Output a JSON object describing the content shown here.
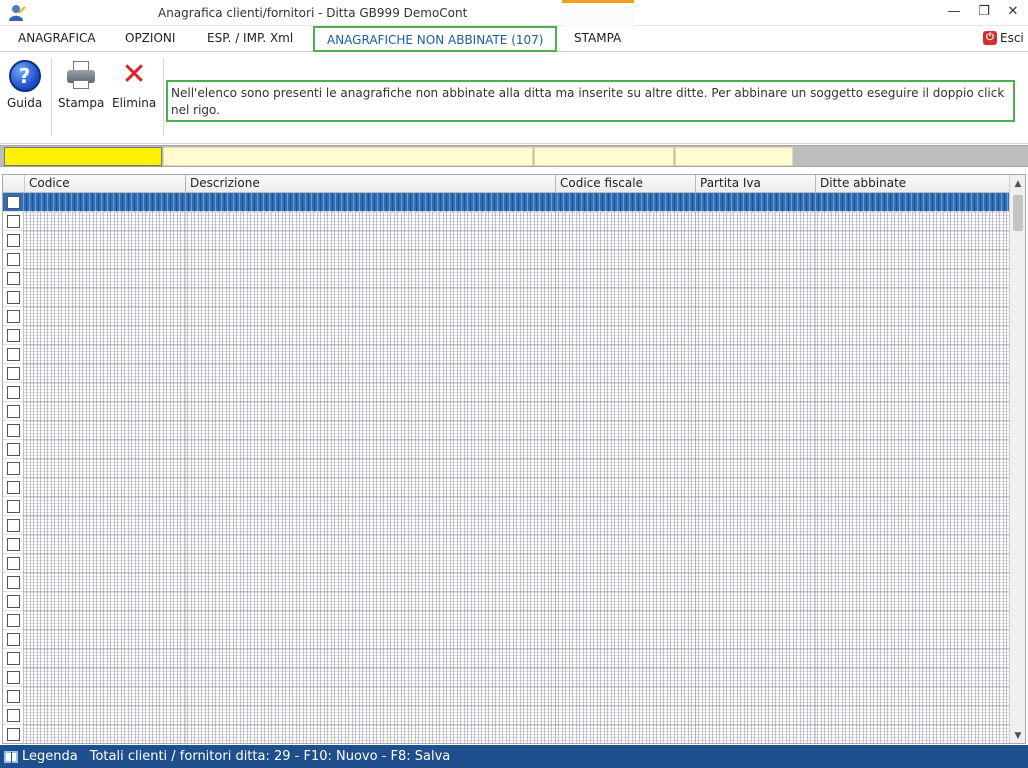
{
  "window": {
    "title": "Anagrafica clienti/fornitori - Ditta GB999 DemoCont",
    "min_glyph": "—",
    "max_glyph": "❐",
    "close_glyph": "✕"
  },
  "menu": {
    "tabs": [
      {
        "label": "ANAGRAFICA"
      },
      {
        "label": "OPZIONI"
      },
      {
        "label": "ESP. / IMP. Xml"
      },
      {
        "label": "ANAGRAFICHE NON ABBINATE (107)"
      },
      {
        "label": "STAMPA"
      }
    ],
    "active_tab": "ANAGRAFICHE NON ABBINATE (107)",
    "exit_label": "Esci"
  },
  "toolbar": {
    "help_label": "Guida",
    "print_label": "Stampa",
    "delete_label": "Elimina",
    "info_text": "Nell'elenco sono presenti le anagrafiche non abbinate alla ditta ma inserite su altre ditte. Per abbinare un soggetto eseguire il doppio click nel rigo."
  },
  "grid": {
    "columns": [
      "Codice",
      "Descrizione",
      "Codice fiscale",
      "Partita Iva",
      "Ditte abbinate"
    ],
    "visible_rows": 29,
    "selected_row": 0
  },
  "status": {
    "legend_label": "Legenda",
    "summary": "Totali clienti / fornitori ditta: 29  -  F10: Nuovo - F8: Salva"
  },
  "colors": {
    "accent_border": "#4caf50",
    "status_bar": "#1e4f8c",
    "filter_highlight": "#ffef00",
    "selected_row": "#2f6fb8"
  }
}
